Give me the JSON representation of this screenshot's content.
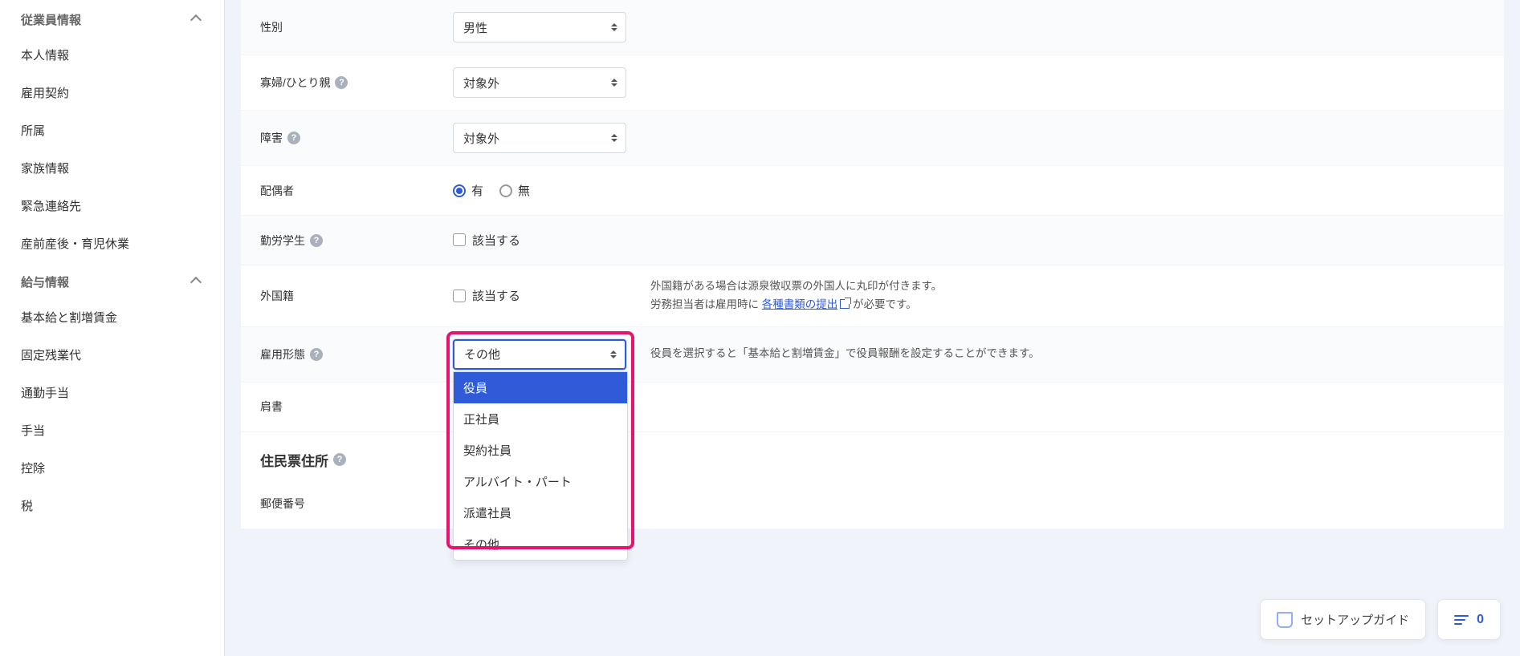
{
  "sidebar": {
    "sections": [
      {
        "title": "従業員情報",
        "items": [
          "本人情報",
          "雇用契約",
          "所属",
          "家族情報",
          "緊急連絡先",
          "産前産後・育児休業"
        ]
      },
      {
        "title": "給与情報",
        "items": [
          "基本給と割増賃金",
          "固定残業代",
          "通勤手当",
          "手当",
          "控除",
          "税"
        ]
      }
    ]
  },
  "form": {
    "gender": {
      "label": "性別",
      "value": "男性"
    },
    "widow": {
      "label": "寡婦/ひとり親",
      "value": "対象外"
    },
    "disability": {
      "label": "障害",
      "value": "対象外"
    },
    "spouse": {
      "label": "配偶者",
      "option_yes": "有",
      "option_no": "無",
      "value": "yes"
    },
    "working_student": {
      "label": "勤労学生",
      "option": "該当する"
    },
    "foreign": {
      "label": "外国籍",
      "option": "該当する",
      "help_line1": "外国籍がある場合は源泉徴収票の外国人に丸印が付きます。",
      "help_line2_pre": "労務担当者は雇用時に ",
      "help_link": "各種書類の提出",
      "help_line2_post": " が必要です。"
    },
    "employment_type": {
      "label": "雇用形態",
      "value": "その他",
      "options": [
        "役員",
        "正社員",
        "契約社員",
        "アルバイト・パート",
        "派遣社員",
        "その他"
      ],
      "help": "役員を選択すると「基本給と割増賃金」で役員報酬を設定することができます。"
    },
    "title": {
      "label": "肩書"
    },
    "residence_section": "住民票住所",
    "postal_code": {
      "label": "郵便番号"
    }
  },
  "floating": {
    "setup_guide": "セットアップガイド",
    "count": "0"
  }
}
